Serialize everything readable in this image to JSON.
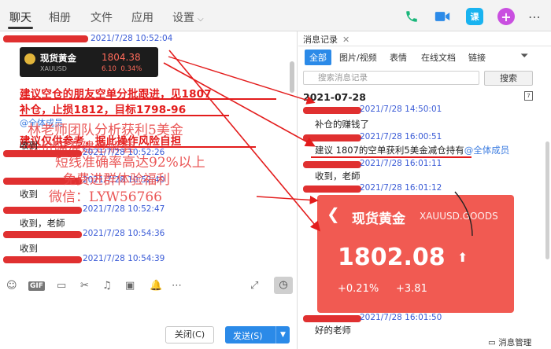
{
  "nav": {
    "tabs": [
      {
        "label": "聊天"
      },
      {
        "label": "相册"
      },
      {
        "label": "文件"
      },
      {
        "label": "应用"
      },
      {
        "label": "设置"
      }
    ],
    "class_icon_label": "课",
    "plus_icon_label": "+"
  },
  "chat": {
    "messages": [
      {
        "time": "2021/7/28 10:52:04"
      },
      {
        "time": "2021/7/28 10:52:26",
        "text": "收到"
      },
      {
        "time": "2021/7/28 10:52:40",
        "text": "收到"
      },
      {
        "time": "2021/7/28 10:52:47",
        "text": "收到，老師"
      },
      {
        "time": "2021/7/28 10:54:36",
        "text": "收到"
      },
      {
        "time": "2021/7/28 10:54:39"
      }
    ],
    "quote_card": {
      "name": "现货黄金",
      "code": "XAUUSD",
      "price": "1804.38",
      "change": "6.10",
      "change_pct": "0.34%"
    },
    "red_annotation": {
      "line1": "建议空仓的朋友空单分批跟进，见1807",
      "line2": "补仓，止损1812，目标1798-96",
      "line3": "建议仅供参考，据此操作风险自担"
    },
    "at_all": "@全体成员",
    "overlay": {
      "line1": "林老师团队分析获利5美金",
      "line2": "现价瞄准建仓解套",
      "line3": "短线准确率高达92%以上",
      "line4": "免费进群体验福利",
      "line5": "微信：LYW56766"
    },
    "toolbar": {
      "gif_label": "GIF"
    },
    "buttons": {
      "close_label": "关闭(C)",
      "send_label": "发送(S)"
    }
  },
  "history": {
    "tab_label": "消息记录",
    "filters": [
      "全部",
      "图片/视频",
      "表情",
      "在线文档",
      "链接"
    ],
    "search_placeholder": "搜索消息记录",
    "search_button": "搜索",
    "date": "2021-07-28",
    "calendar_label": "7",
    "records": [
      {
        "time": "2021/7/28 14:50:01",
        "text": "补仓的赚钱了"
      },
      {
        "time": "2021/7/28 16:00:51",
        "text": "建议 1807的空单获利5美金减仓持有",
        "mention": "@全体成员"
      },
      {
        "time": "2021/7/28 16:01:11",
        "text": "收到，老師"
      },
      {
        "time": "2021/7/28 16:01:12"
      },
      {
        "time": "2021/7/28 16:01:50",
        "text": "好的老师"
      }
    ],
    "big_card": {
      "name": "现货黄金",
      "code": "XAUUSD.GOODS",
      "price": "1802.08",
      "change_pct": "+0.21%",
      "change": "+3.81"
    },
    "manage_label": "消息管理"
  }
}
